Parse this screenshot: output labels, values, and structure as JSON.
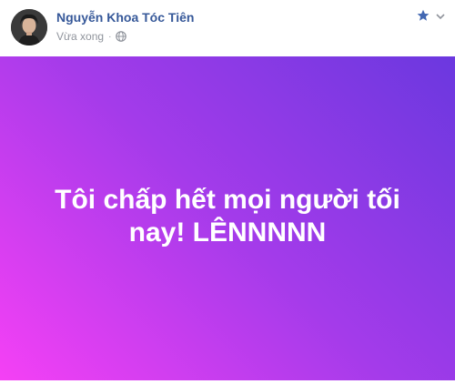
{
  "post": {
    "author_name": "Nguyễn Khoa Tóc Tiên",
    "timestamp": "Vừa xong",
    "separator": "·",
    "privacy_icon": "globe-icon",
    "status_text": "Tôi chấp hết mọi người tối nay! LÊNNNNN",
    "background_gradient": [
      "#f540f5",
      "#a43bea",
      "#6b38df"
    ]
  },
  "header_actions": {
    "star_icon": "star-icon",
    "menu_icon": "chevron-down-icon",
    "accent_color": "#4267b2"
  }
}
